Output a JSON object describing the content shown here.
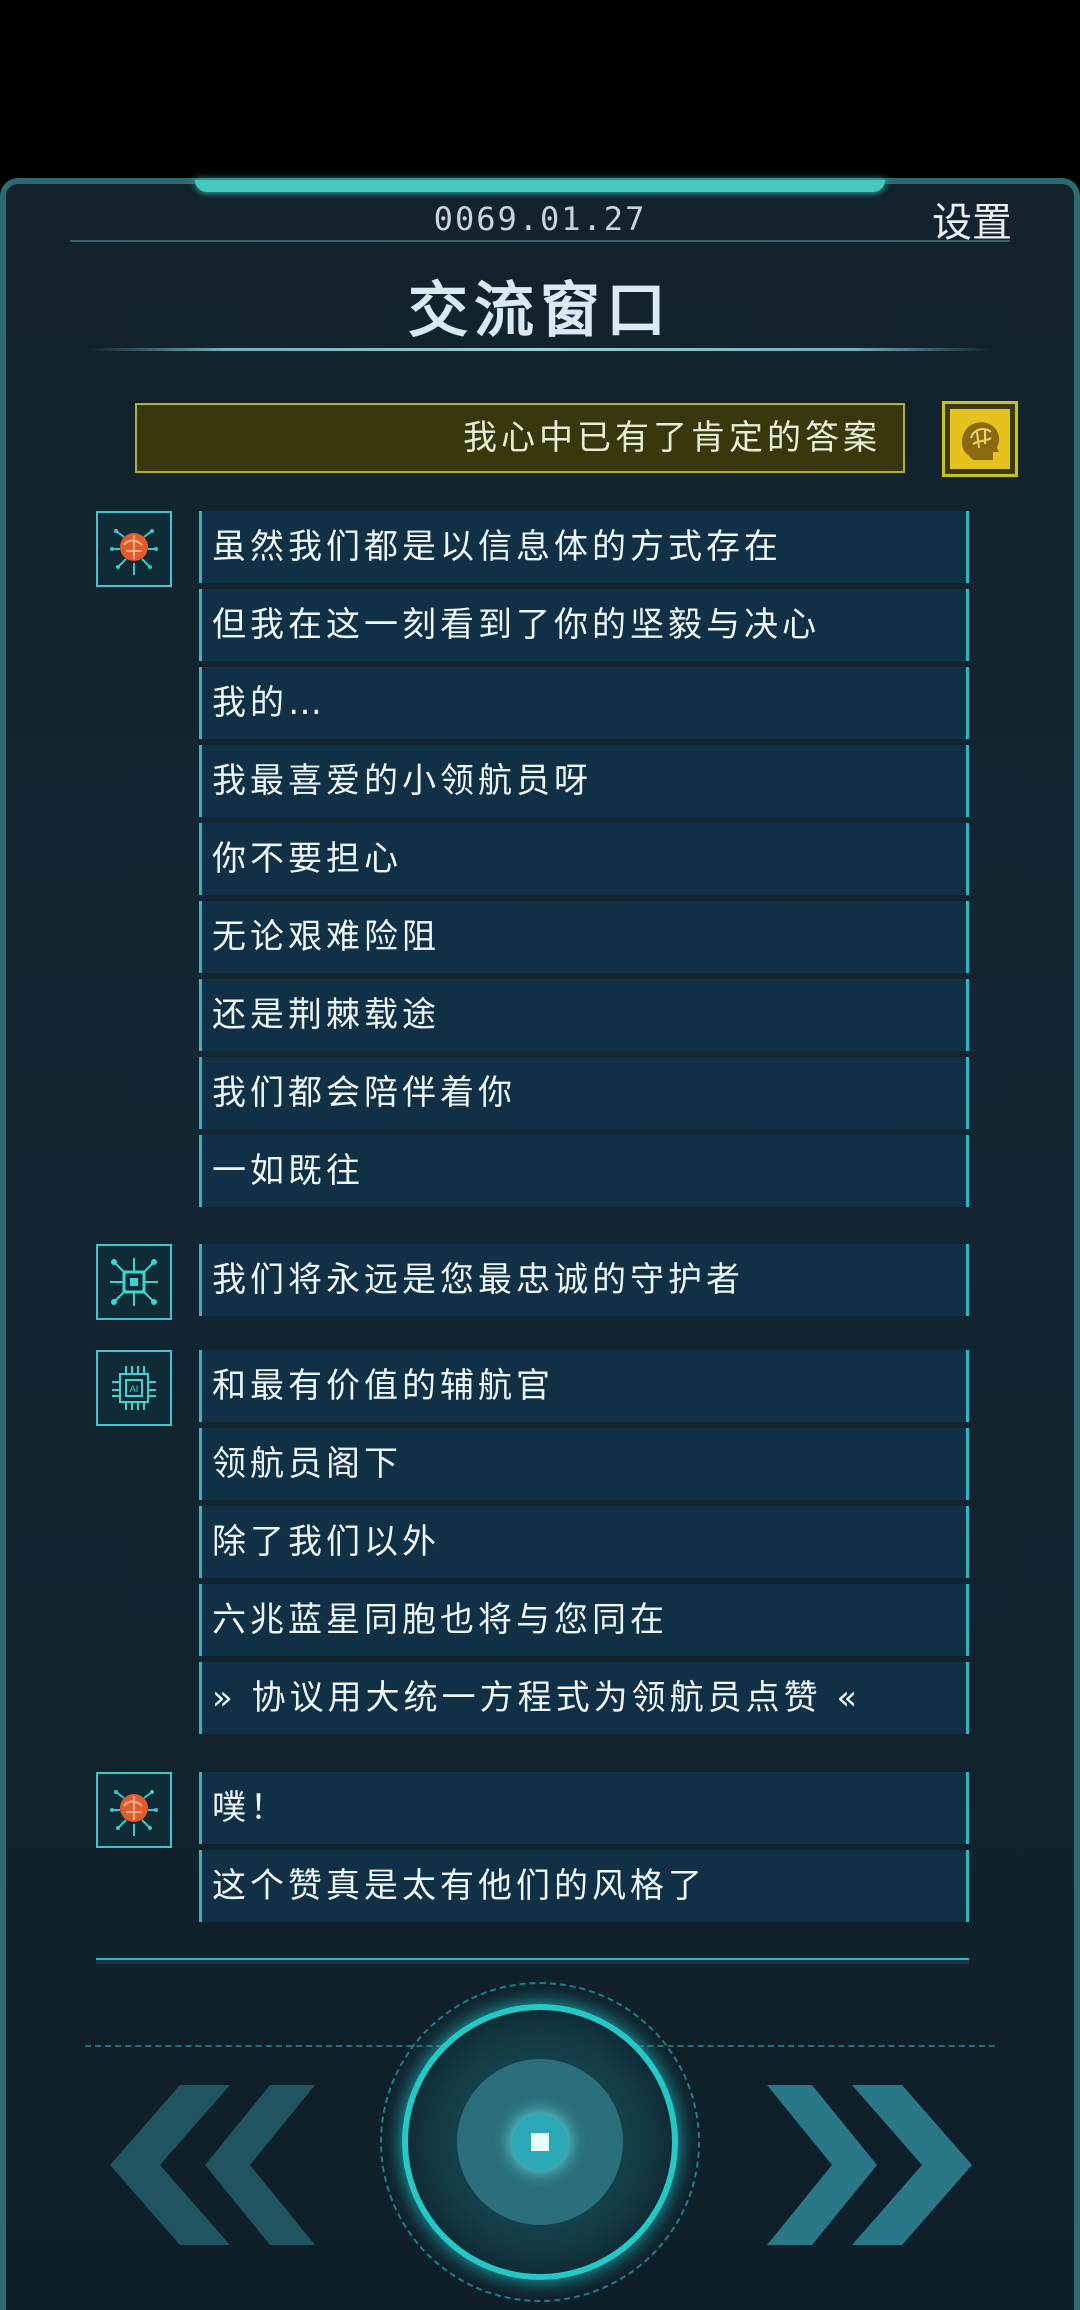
{
  "header": {
    "date": "0069.01.27",
    "settings_label": "设置",
    "title": "交流窗口"
  },
  "player": {
    "message": "我心中已有了肯定的答案"
  },
  "groups": [
    {
      "avatar": "cyber-brain-icon",
      "messages": [
        "虽然我们都是以信息体的方式存在",
        "但我在这一刻看到了你的坚毅与决心",
        "我的…",
        "我最喜爱的小领航员呀",
        "你不要担心",
        "无论艰难险阻",
        "还是荆棘载途",
        "我们都会陪伴着你",
        "一如既往"
      ]
    },
    {
      "avatar": "circuit-chip-icon",
      "messages": [
        "我们将永远是您最忠诚的守护者"
      ]
    },
    {
      "avatar": "ai-chip-icon",
      "messages": [
        "和最有价值的辅航官",
        "领航员阁下",
        "除了我们以外",
        "六兆蓝星同胞也将与您同在",
        "» 协议用大统一方程式为领航员点赞 «"
      ]
    },
    {
      "avatar": "cyber-brain-icon",
      "messages": [
        "噗！",
        "这个赞真是太有他们的风格了"
      ]
    }
  ],
  "colors": {
    "accent": "#2ab7c7",
    "player_bubble": "#38380c",
    "player_border": "#b3b11f",
    "npc_bubble": "#0f3045"
  }
}
